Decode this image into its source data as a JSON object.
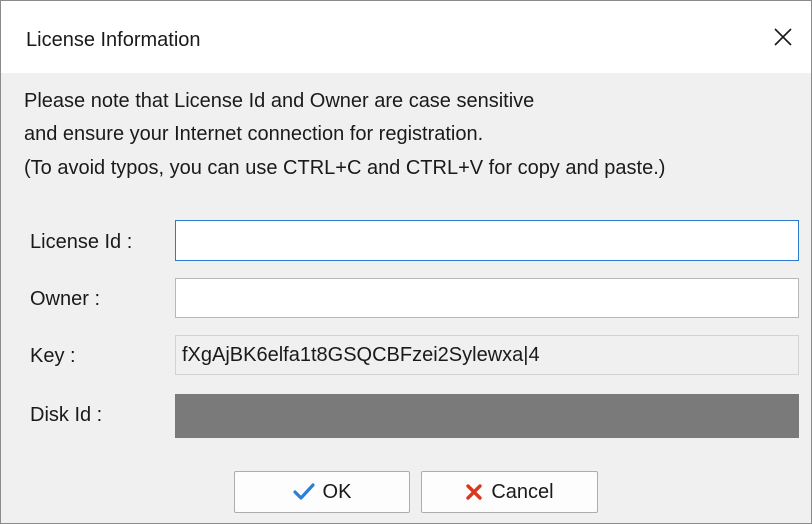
{
  "window": {
    "title": "License Information",
    "close_icon": "close-x-icon"
  },
  "message": {
    "line1": "Please note that License Id and Owner are case sensitive",
    "line2": "and ensure your Internet connection for registration.",
    "line3": "(To avoid typos, you can use CTRL+C and CTRL+V for copy and paste.)"
  },
  "fields": {
    "license_id": {
      "label": "License Id :",
      "value": ""
    },
    "owner": {
      "label": "Owner :",
      "value": ""
    },
    "key": {
      "label": "Key :",
      "value": "fXgAjBK6elfa1t8GSQCBFzei2Sylewxa|4"
    },
    "disk_id": {
      "label": "Disk Id :",
      "value": ""
    }
  },
  "buttons": {
    "ok": {
      "label": "OK",
      "icon": "checkmark-icon",
      "icon_color": "#2b7fd6"
    },
    "cancel": {
      "label": "Cancel",
      "icon": "red-x-icon",
      "icon_color": "#d9381e"
    }
  },
  "colors": {
    "accent_focus_border": "#2a7ad0",
    "disk_fill": "#7a7a7a",
    "dialog_bg": "#f0f0f0"
  }
}
